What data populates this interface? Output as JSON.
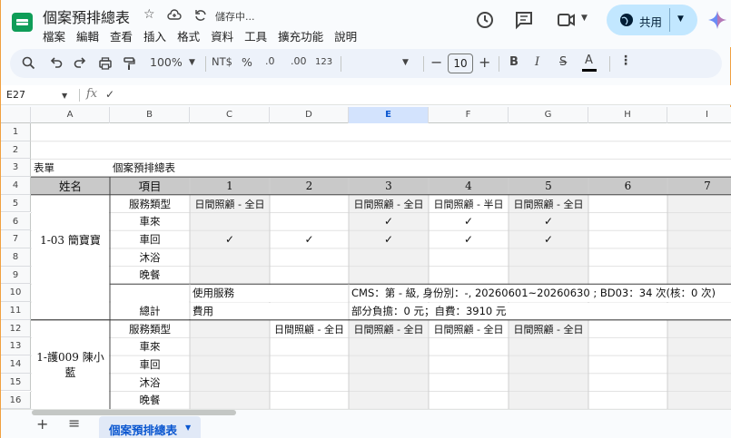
{
  "app": {
    "doc_title": "個案預排總表",
    "save_status": "儲存中...",
    "share_label": "共用",
    "menu": [
      "檔案",
      "編輯",
      "查看",
      "插入",
      "格式",
      "資料",
      "工具",
      "擴充功能",
      "說明"
    ]
  },
  "toolbar": {
    "zoom": "100%",
    "currency": "NT$",
    "percent": "%",
    "dec_decrease": ".0",
    "dec_increase": ".00",
    "number_format": "123",
    "font_size": "10",
    "bold": "B",
    "italic": "I",
    "strike": "S",
    "text_color": "A"
  },
  "formula": {
    "name_box": "E27",
    "fx": "fx",
    "check": "✓"
  },
  "columns": [
    "A",
    "B",
    "C",
    "D",
    "E",
    "F",
    "G",
    "H",
    "I"
  ],
  "rows": [
    "1",
    "2",
    "3",
    "4",
    "5",
    "6",
    "7",
    "8",
    "9",
    "10",
    "11",
    "12",
    "13",
    "14",
    "15",
    "16"
  ],
  "sheet": {
    "r3_a": "表單",
    "r3_b": "個案預排總表",
    "header_name": "姓名",
    "header_item": "項目",
    "days": [
      "1",
      "2",
      "3",
      "4",
      "5",
      "6",
      "7"
    ],
    "items": [
      "服務類型",
      "車來",
      "車回",
      "沐浴",
      "晚餐"
    ],
    "client1_name": "1-03 簡寶寶",
    "client1_service": {
      "c": "日間照顧 - 全日",
      "e": "日間照顧 - 全日",
      "f": "日間照顧 - 半日",
      "g": "日間照顧 - 全日"
    },
    "check": "✓",
    "total_label": "總計",
    "used_label": "使用服務",
    "fee_label": "費用",
    "used_value": "CMS：第 - 級, 身份別：-, 20260601~20260630 ; BD03：34 次(核：0 次)",
    "fee_value": "部分負擔：0 元；自費：3910 元",
    "client2_name_l1": "1-護009 陳小",
    "client2_name_l2": "藍",
    "client2_service": {
      "d": "日間照顧 - 全日",
      "e": "日間照顧 - 全日",
      "f": "日間照顧 - 全日",
      "g": "日間照顧 - 全日"
    }
  },
  "tabs": {
    "add": "+",
    "list": "≡",
    "active": "個案預排總表"
  }
}
